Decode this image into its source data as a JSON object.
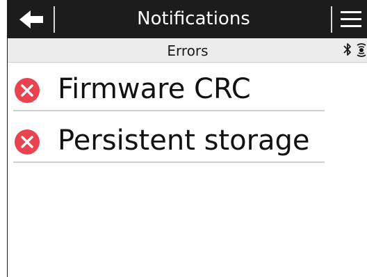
{
  "header": {
    "title": "Notifications",
    "back_icon": "arrow-left-icon",
    "menu_icon": "hamburger-menu-icon",
    "background_color": "#1c1c1c",
    "text_color": "#ffffff"
  },
  "subheader": {
    "title": "Errors",
    "status_icons": [
      "bluetooth-icon",
      "signal-icon"
    ]
  },
  "notifications": [
    {
      "label": "Firmware CRC",
      "icon": "error-icon",
      "icon_color": "#e8434f"
    },
    {
      "label": "Persistent storage",
      "icon": "error-icon",
      "icon_color": "#e8434f"
    }
  ]
}
